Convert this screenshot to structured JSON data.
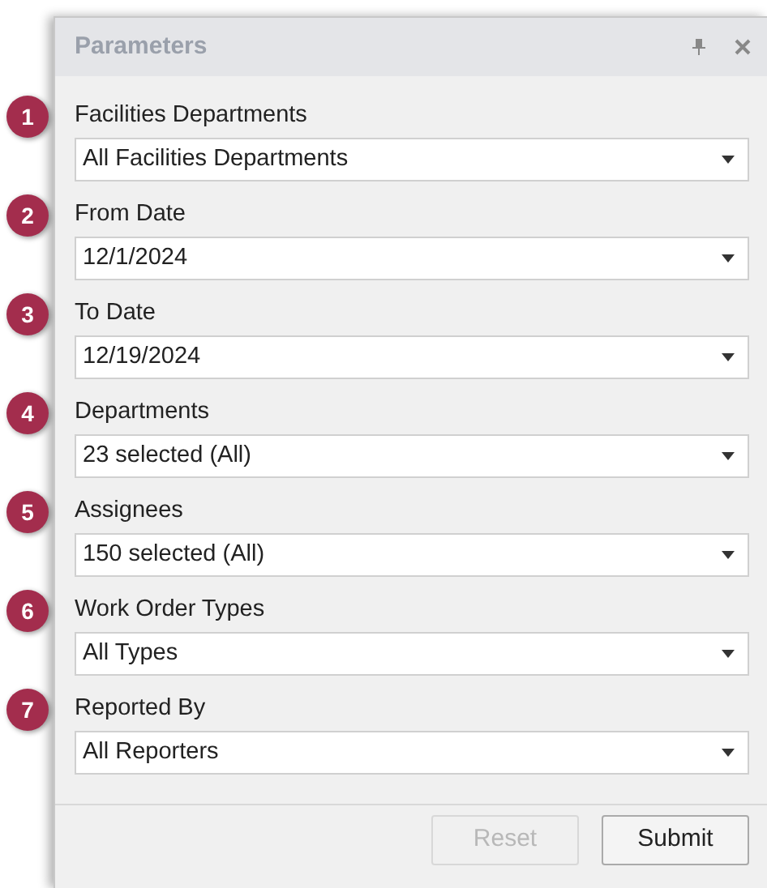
{
  "panel": {
    "title": "Parameters"
  },
  "parameters": [
    {
      "number": "1",
      "label": "Facilities Departments",
      "value": "All Facilities Departments"
    },
    {
      "number": "2",
      "label": "From Date",
      "value": "12/1/2024"
    },
    {
      "number": "3",
      "label": "To Date",
      "value": "12/19/2024"
    },
    {
      "number": "4",
      "label": "Departments",
      "value": "23 selected (All)"
    },
    {
      "number": "5",
      "label": "Assignees",
      "value": "150 selected (All)"
    },
    {
      "number": "6",
      "label": "Work Order Types",
      "value": "All Types"
    },
    {
      "number": "7",
      "label": "Reported By",
      "value": "All Reporters"
    }
  ],
  "buttons": [
    {
      "label": "Reset",
      "disabled": true
    },
    {
      "label": "Submit",
      "disabled": false
    }
  ]
}
